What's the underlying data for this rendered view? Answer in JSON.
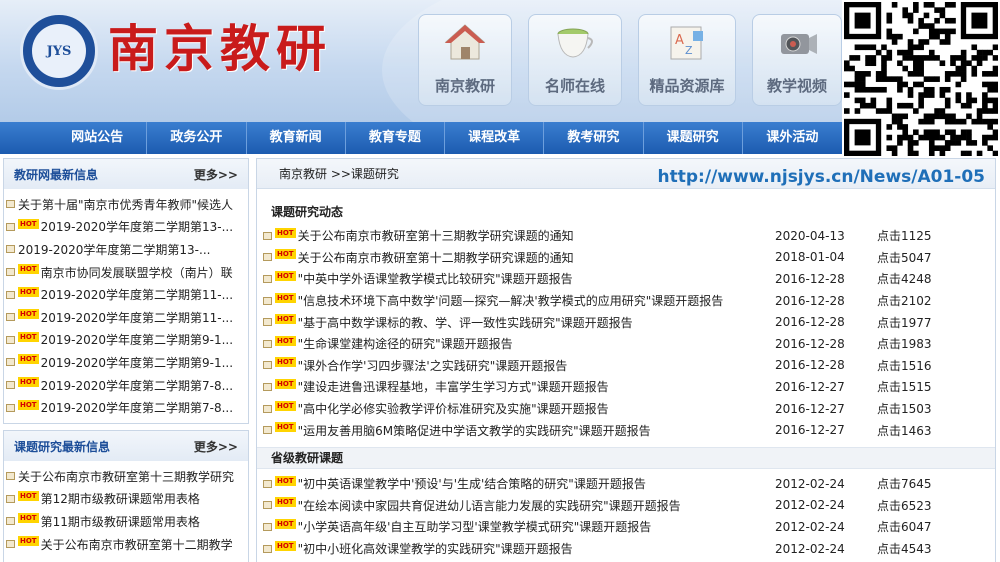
{
  "header": {
    "logo_text": "JYS",
    "site_title": "南京教研"
  },
  "tiles": [
    {
      "label": "南京教研",
      "icon": "house-icon"
    },
    {
      "label": "名师在线",
      "icon": "teacup-icon"
    },
    {
      "label": "精品资源库",
      "icon": "resource-icon"
    },
    {
      "label": "教学视频",
      "icon": "camera-icon"
    }
  ],
  "nav": [
    "网站公告",
    "政务公开",
    "教育新闻",
    "教育专题",
    "课程改革",
    "教考研究",
    "课题研究",
    "课外活动"
  ],
  "panel1": {
    "title": "教研网最新信息",
    "more": "更多>>",
    "items": [
      {
        "text": "关于第十届\"南京市优秀青年教师\"候选人",
        "new": false
      },
      {
        "text": "2019-2020学年度第二学期第13-...",
        "new": true
      },
      {
        "text": "2019-2020学年度第二学期第13-...",
        "new": false
      },
      {
        "text": "南京市协同发展联盟学校（南片）联",
        "new": true
      },
      {
        "text": "2019-2020学年度第二学期第11-...",
        "new": true
      },
      {
        "text": "2019-2020学年度第二学期第11-...",
        "new": true
      },
      {
        "text": "2019-2020学年度第二学期第9-1...",
        "new": true
      },
      {
        "text": "2019-2020学年度第二学期第9-1...",
        "new": true
      },
      {
        "text": "2019-2020学年度第二学期第7-8...",
        "new": true
      },
      {
        "text": "2019-2020学年度第二学期第7-8...",
        "new": true
      }
    ]
  },
  "panel2": {
    "title": "课题研究最新信息",
    "more": "更多>>",
    "items": [
      {
        "text": "关于公布南京市教研室第十三期教学研究",
        "new": false
      },
      {
        "text": "第12期市级教研课题常用表格",
        "new": true
      },
      {
        "text": "第11期市级教研课题常用表格",
        "new": true
      },
      {
        "text": "关于公布南京市教研室第十二期教学",
        "new": true
      }
    ]
  },
  "new_badge": "HOT",
  "breadcrumb": "南京教研 >>课题研究",
  "url": "http://www.njsjys.cn/News/A01-05",
  "section1": {
    "title": "课题研究动态",
    "rows": [
      {
        "title": "关于公布南京市教研室第十三期教学研究课题的通知",
        "date": "2020-04-13",
        "hits": "点击1125"
      },
      {
        "title": "关于公布南京市教研室第十二期教学研究课题的通知",
        "date": "2018-01-04",
        "hits": "点击5047"
      },
      {
        "title": "\"中英中学外语课堂教学模式比较研究\"课题开题报告",
        "date": "2016-12-28",
        "hits": "点击4248"
      },
      {
        "title": "\"信息技术环境下高中数学'问题—探究—解决'教学模式的应用研究\"课题开题报告",
        "date": "2016-12-28",
        "hits": "点击2102"
      },
      {
        "title": "\"基于高中数学课标的教、学、评一致性实践研究\"课题开题报告",
        "date": "2016-12-28",
        "hits": "点击1977"
      },
      {
        "title": "\"生命课堂建构途径的研究\"课题开题报告",
        "date": "2016-12-28",
        "hits": "点击1983"
      },
      {
        "title": "\"课外合作学'习四步骤法'之实践研究\"课题开题报告",
        "date": "2016-12-28",
        "hits": "点击1516"
      },
      {
        "title": "\"建设走进鲁迅课程基地，丰富学生学习方式\"课题开题报告",
        "date": "2016-12-27",
        "hits": "点击1515"
      },
      {
        "title": "\"高中化学必修实验教学评价标准研究及实施\"课题开题报告",
        "date": "2016-12-27",
        "hits": "点击1503"
      },
      {
        "title": "\"运用友善用脑6M策略促进中学语文教学的实践研究\"课题开题报告",
        "date": "2016-12-27",
        "hits": "点击1463"
      }
    ]
  },
  "section2": {
    "title": "省级教研课题",
    "rows": [
      {
        "title": "\"初中英语课堂教学中'预设'与'生成'结合策略的研究\"课题开题报告",
        "date": "2012-02-24",
        "hits": "点击7645"
      },
      {
        "title": "\"在绘本阅读中家园共育促进幼儿语言能力发展的实践研究\"课题开题报告",
        "date": "2012-02-24",
        "hits": "点击6523"
      },
      {
        "title": "\"小学英语高年级'自主互助学习型'课堂教学模式研究\"课题开题报告",
        "date": "2012-02-24",
        "hits": "点击6047"
      },
      {
        "title": "\"初中小班化高效课堂教学的实践研究\"课题开题报告",
        "date": "2012-02-24",
        "hits": "点击4543"
      }
    ]
  },
  "colors": {
    "nav": "#1c5bb0",
    "title_red": "#c91b1b",
    "badge_bg": "#ffd400",
    "badge_fg": "#d40000",
    "link_blue": "#1d4e99"
  }
}
